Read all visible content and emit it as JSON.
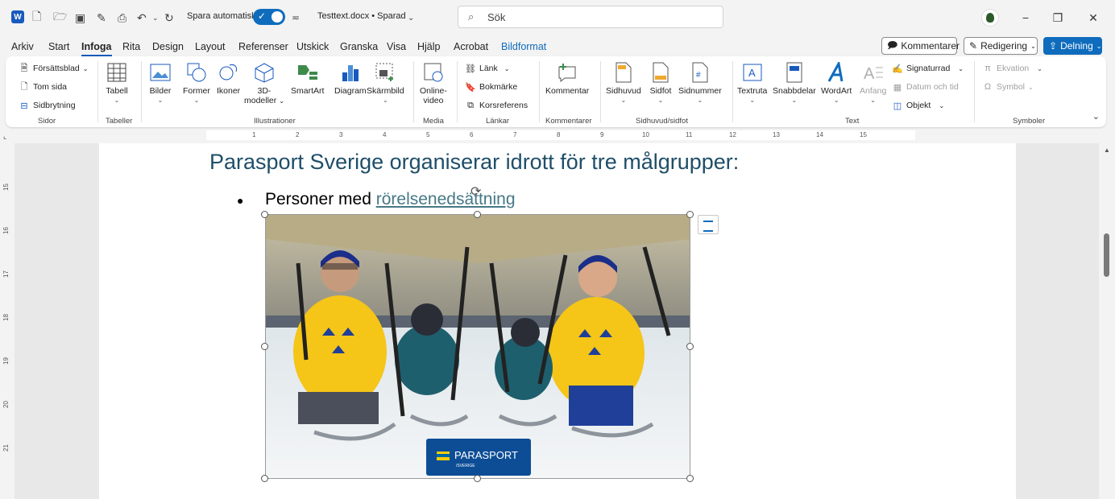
{
  "titlebar": {
    "autosave_label": "Spara automatiskt",
    "document_name": "Testtext.docx • Sparad",
    "search_placeholder": "Sök"
  },
  "menu": {
    "items": [
      "Arkiv",
      "Start",
      "Infoga",
      "Rita",
      "Design",
      "Layout",
      "Referenser",
      "Utskick",
      "Granska",
      "Visa",
      "Hjälp",
      "Acrobat",
      "Bildformat"
    ],
    "active": "Infoga",
    "comments_button": "Kommentarer",
    "editing_button": "Redigering",
    "share_button": "Delning"
  },
  "ribbon": {
    "pages": {
      "label": "Sidor",
      "cover": "Försättsblad",
      "blank": "Tom sida",
      "break": "Sidbrytning"
    },
    "tables": {
      "label": "Tabeller",
      "table": "Tabell"
    },
    "illustrations": {
      "label": "Illustrationer",
      "pictures": "Bilder",
      "shapes": "Former",
      "icons": "Ikoner",
      "models_line1": "3D-",
      "models_line2": "modeller",
      "smartart": "SmartArt",
      "chart": "Diagram",
      "screenshot": "Skärmbild"
    },
    "media": {
      "label": "Media",
      "video_line1": "Online-",
      "video_line2": "video"
    },
    "links": {
      "label": "Länkar",
      "link": "Länk",
      "bookmark": "Bokmärke",
      "crossref": "Korsreferens"
    },
    "comments": {
      "label": "Kommentarer",
      "comment": "Kommentar"
    },
    "headerfooter": {
      "label": "Sidhuvud/sidfot",
      "header": "Sidhuvud",
      "footer": "Sidfot",
      "pagenumber": "Sidnummer"
    },
    "text": {
      "label": "Text",
      "textbox": "Textruta",
      "quickparts": "Snabbdelar",
      "wordart": "WordArt",
      "dropcap": "Anfang",
      "signature": "Signaturrad",
      "datetime": "Datum och tid",
      "object": "Objekt"
    },
    "symbols": {
      "label": "Symboler",
      "equation": "Ekvation",
      "symbol": "Symbol"
    }
  },
  "ruler": {
    "top": [
      "1",
      "2",
      "3",
      "4",
      "5",
      "6",
      "7",
      "8",
      "9",
      "10",
      "11",
      "12",
      "13",
      "14",
      "15"
    ],
    "left": [
      "15",
      "16",
      "17",
      "18",
      "19",
      "20",
      "21"
    ]
  },
  "document": {
    "heading": "Parasport Sverige organiserar idrott för tre målgrupper:",
    "bullet_prefix": "Personer med ",
    "bullet_link": "rörelsenedsättning",
    "image_logo_text": "PARASPORT",
    "image_logo_sub": "/SVERIGE"
  },
  "colors": {
    "accent": "#185abd",
    "heading": "#1f4e68",
    "link": "#467886",
    "jersey": "#f5c518"
  }
}
